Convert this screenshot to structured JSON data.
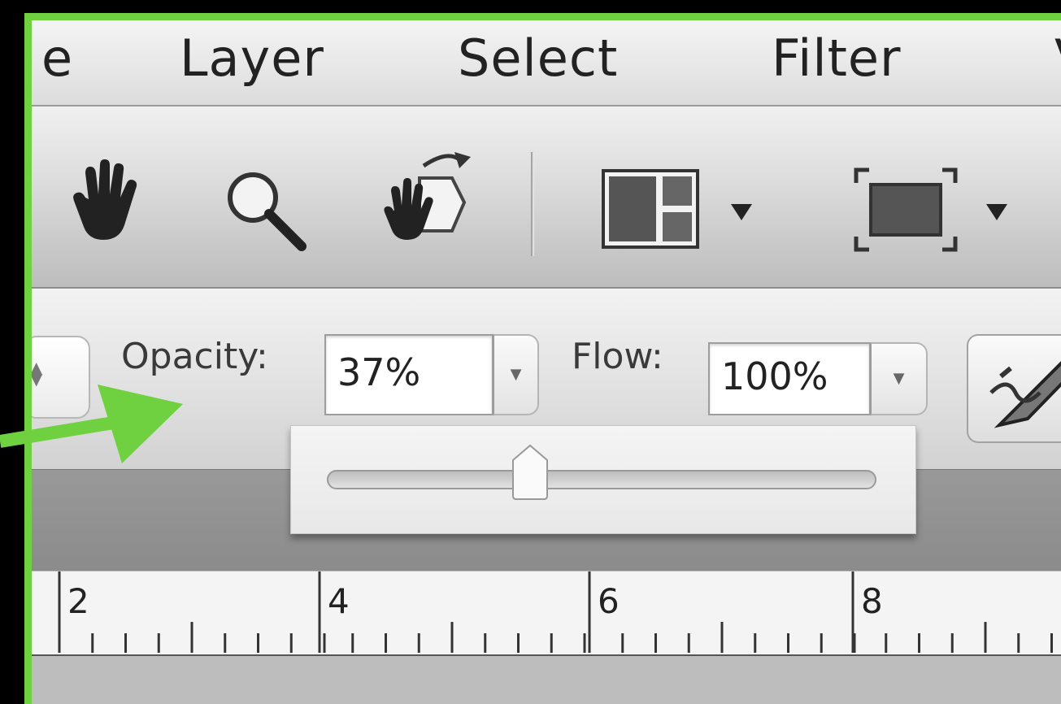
{
  "menu": {
    "items": [
      "e",
      "Layer",
      "Select",
      "Filter",
      "V"
    ]
  },
  "toolbar": {
    "icons": [
      "hand-icon",
      "zoom-icon",
      "rotate-view-icon",
      "arrange-documents-icon",
      "screen-mode-icon"
    ]
  },
  "options": {
    "opacity_label": "Opacity:",
    "opacity_value": "37%",
    "flow_label": "Flow:",
    "flow_value": "100%",
    "slider_value_percent": 37
  },
  "ruler": {
    "labels": [
      "2",
      "4",
      "6",
      "8"
    ]
  },
  "colors": {
    "highlight": "#6fd13f"
  }
}
